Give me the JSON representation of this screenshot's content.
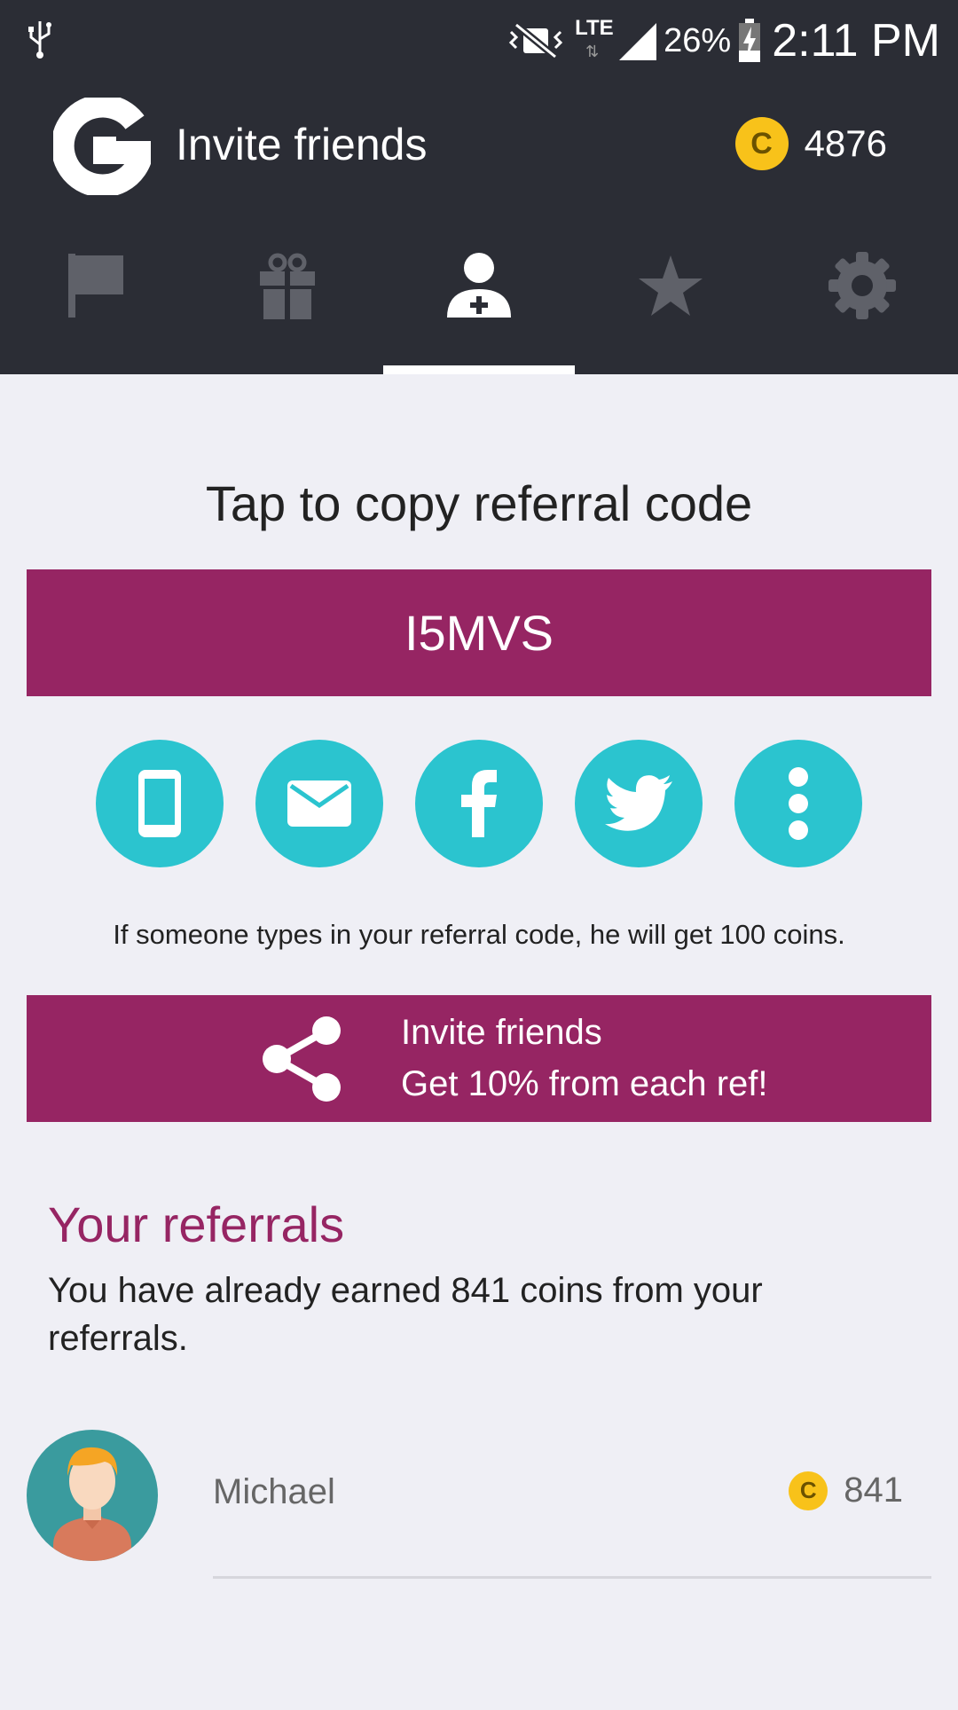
{
  "status_bar": {
    "network": "LTE",
    "battery": "26%",
    "time": "2:11 PM"
  },
  "header": {
    "title": "Invite friends",
    "coin_symbol": "C",
    "coin_balance": "4876"
  },
  "tabs": [
    {
      "icon": "flag-icon",
      "active": false
    },
    {
      "icon": "gift-icon",
      "active": false
    },
    {
      "icon": "add-person-icon",
      "active": true
    },
    {
      "icon": "star-icon",
      "active": false
    },
    {
      "icon": "gear-icon",
      "active": false
    }
  ],
  "referral": {
    "copy_title": "Tap to copy referral code",
    "code": "I5MVS",
    "share_options": [
      "sms-icon",
      "email-icon",
      "facebook-icon",
      "twitter-icon",
      "more-icon"
    ],
    "hint": "If someone types in your referral code, he will get 100 coins."
  },
  "invite": {
    "line1": "Invite friends",
    "line2": "Get 10% from each ref!"
  },
  "referrals": {
    "title": "Your referrals",
    "description": "You have already earned 841 coins from your referrals.",
    "items": [
      {
        "name": "Michael",
        "coin_symbol": "C",
        "coins": "841"
      }
    ]
  },
  "colors": {
    "header_bg": "#2b2d35",
    "accent": "#962563",
    "share_bg": "#2bc4cf",
    "coin": "#f8c21a",
    "page_bg": "#efeff5"
  }
}
